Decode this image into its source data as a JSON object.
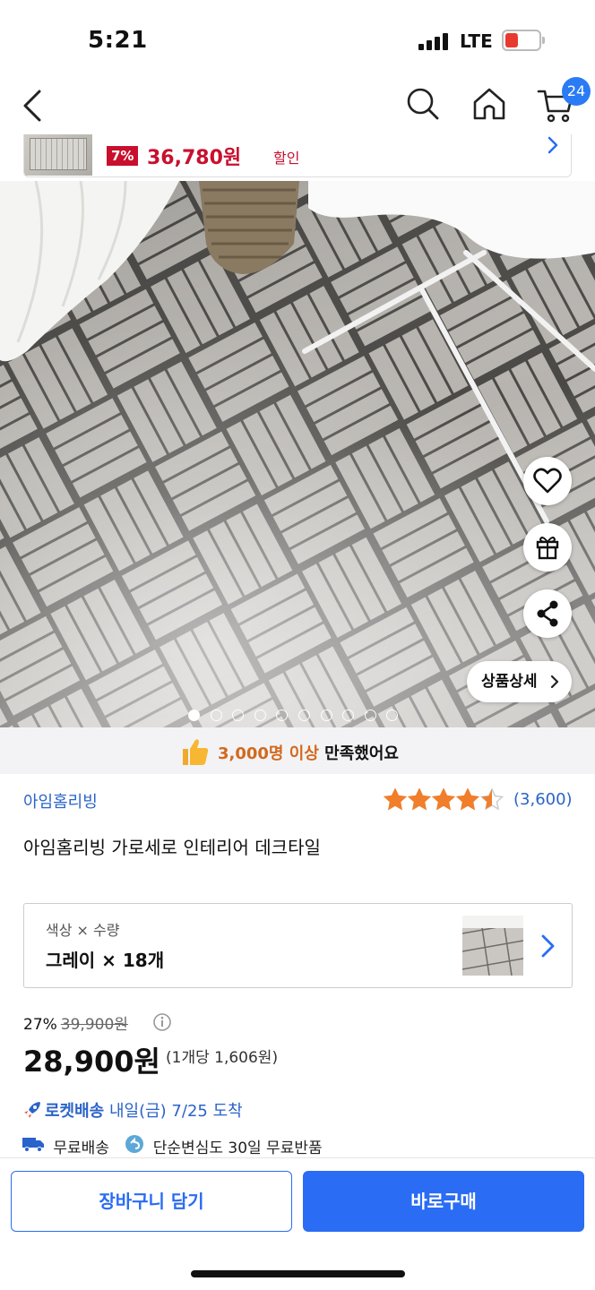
{
  "status_bar": {
    "time": "5:21",
    "network": "LTE",
    "battery_level": "7",
    "battery_color": "#e8392e"
  },
  "nav": {
    "cart_count": "24",
    "icons": [
      "back-icon",
      "search-icon",
      "home-icon",
      "cart-icon"
    ]
  },
  "mini_bar": {
    "discount": "7%",
    "price": "36,780원",
    "sale_label": "할인"
  },
  "hero": {
    "detail_button": "상품상세",
    "slide_total": 10,
    "slide_current": 1
  },
  "satisfaction": {
    "highlight": "3,000명 이상",
    "suffix": "만족했어요"
  },
  "product": {
    "brand": "아임홈리빙",
    "rating_stars": 4.5,
    "review_count": "(3,600)",
    "title": "아임홈리빙 가로세로 인테리어 데크타일"
  },
  "option": {
    "label": "색상 × 수량",
    "value": "그레이 × 18개"
  },
  "price": {
    "discount_rate": "27%",
    "original": "39,900원",
    "sale": "28,900원",
    "unit_price": "(1개당 1,606원)"
  },
  "delivery": {
    "rocket_label": "로켓배송",
    "arrival": "내일(금) 7/25 도착",
    "free_shipping": "무료배송",
    "free_return": "단순변심도 30일 무료반품"
  },
  "actions": {
    "cart_button": "장바구니 담기",
    "buy_button": "바로구매"
  },
  "colors": {
    "accent": "#2a6cf4",
    "price_red": "#c8102e",
    "link_blue": "#2a63c9",
    "star": "#f07e2a"
  }
}
